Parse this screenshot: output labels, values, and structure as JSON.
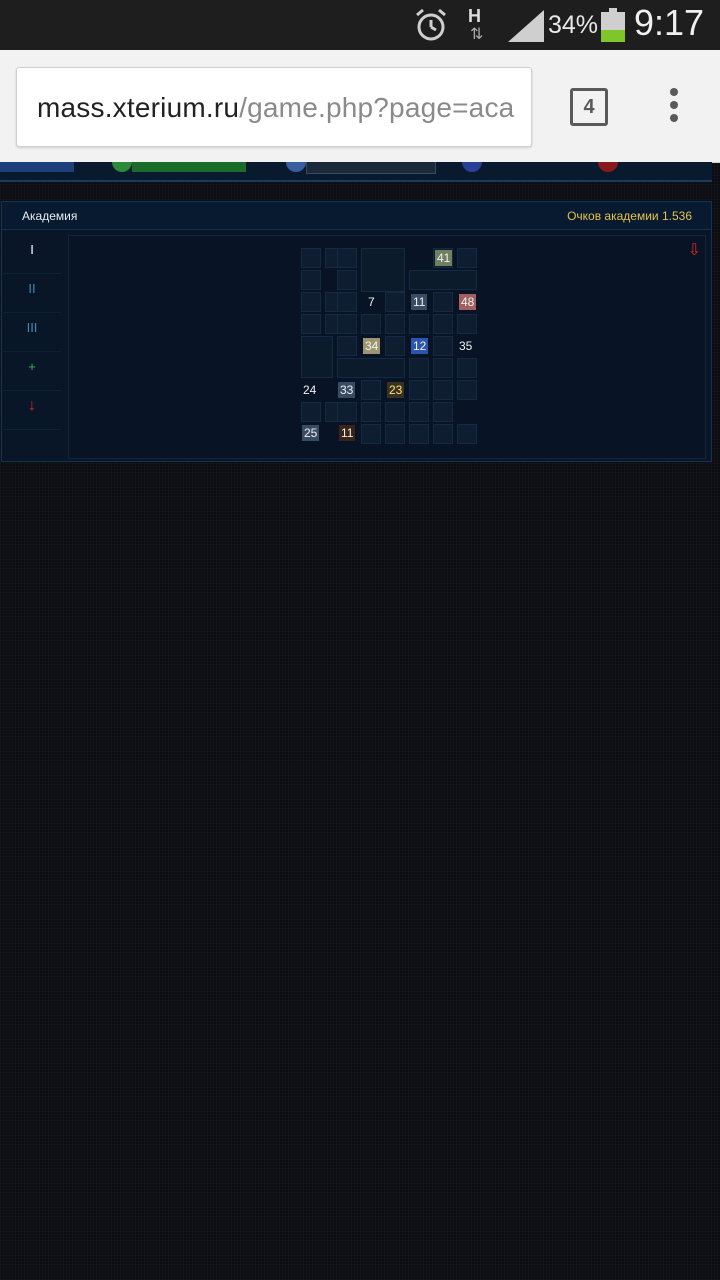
{
  "status_bar": {
    "battery_percent": "34%",
    "network_letter": "H",
    "time": "9:17",
    "icons": [
      "alarm-icon",
      "data-arrows-icon",
      "signal-icon",
      "battery-icon"
    ]
  },
  "browser": {
    "url_host": "mass.xterium.ru",
    "url_path": "/game.php?page=aca",
    "tab_count": "4",
    "menu_icon": "overflow-menu-icon"
  },
  "academy": {
    "title": "Академия",
    "points_label": "Очков академии 1.536",
    "side_tabs": [
      {
        "label": "I"
      },
      {
        "label": "II"
      },
      {
        "label": "III"
      },
      {
        "label": "+"
      },
      {
        "label": "↓"
      }
    ],
    "tree_arrow": "⇩",
    "skills": [
      {
        "label": "41"
      },
      {
        "label": "7"
      },
      {
        "label": "11"
      },
      {
        "label": "48"
      },
      {
        "label": "34"
      },
      {
        "label": "12"
      },
      {
        "label": "35"
      },
      {
        "label": "24"
      },
      {
        "label": "33"
      },
      {
        "label": "23"
      },
      {
        "label": "25"
      },
      {
        "label": "11"
      }
    ]
  },
  "colors": {
    "accent_gold": "#e6c24a",
    "accent_red": "#e02424",
    "panel_bg": "#091627"
  }
}
